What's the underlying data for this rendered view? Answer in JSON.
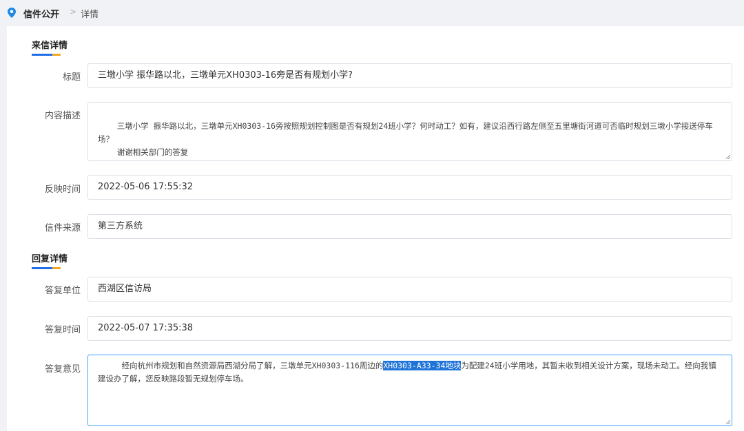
{
  "breadcrumb": {
    "root": "信件公开",
    "separator": ">",
    "current": "详情"
  },
  "letter_section": {
    "title": "来信详情",
    "fields": {
      "title_label": "标题",
      "title_value": "三墩小学 振华路以北，三墩单元XH0303-16旁是否有规划小学?",
      "content_label": "内容描述",
      "content_value": "三墩小学 振华路以北，三墩单元XH0303-16旁按照规划控制图是否有规划24班小学？何时动工？如有，建议沿西行路左侧至五里塘街河道可否临时规划三墩小学接送停车场？\n    谢谢相关部门的答复",
      "time_label": "反映时间",
      "time_value": "2022-05-06 17:55:32",
      "source_label": "信件来源",
      "source_value": "第三方系统"
    }
  },
  "reply_section": {
    "title": "回复详情",
    "fields": {
      "unit_label": "答复单位",
      "unit_value": "西湖区信访局",
      "time_label": "答复时间",
      "time_value": "2022-05-07 17:35:38",
      "opinion_label": "答复意见",
      "opinion_before": "     经向杭州市规划和自然资源局西湖分局了解，三墩单元XH0303-116周边的",
      "opinion_highlight": "XH0303-A33-34地块",
      "opinion_after": "为配建24班小学用地，其暂未收到相关设计方案，现场未动工。经向我镇建设办了解，您反映路段暂无规划停车场。"
    }
  },
  "colors": {
    "accent_blue": "#1e6fe8",
    "accent_orange": "#f5a623",
    "selection": "#1e73d8"
  },
  "icons": {
    "breadcrumb": "location-pin-icon"
  }
}
